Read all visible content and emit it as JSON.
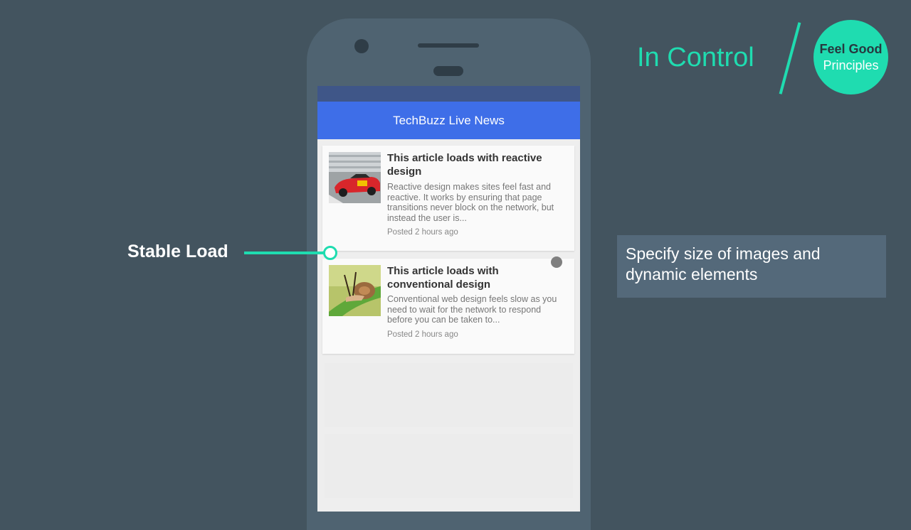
{
  "header": {
    "section_title": "In Control",
    "badge_line1": "Feel Good",
    "badge_line2": "Principles"
  },
  "callout": {
    "label": "Stable Load"
  },
  "info_box": {
    "text": "Specify size of images and dynamic elements"
  },
  "app": {
    "title": "TechBuzz Live News",
    "articles": [
      {
        "title": "This article loads with reactive design",
        "excerpt": "Reactive design makes sites feel fast and reactive. It works by ensuring that page transitions never block on the network, but instead the user is...",
        "time": "Posted 2 hours ago",
        "image": "race-car-image"
      },
      {
        "title": "This article loads with conventional design",
        "excerpt": "Conventional web design feels slow as you need to wait for the network to respond before you can be taken to...",
        "time": "Posted 2 hours ago",
        "image": "snail-image"
      }
    ]
  },
  "colors": {
    "accent": "#1fdcb0",
    "background": "#43545f",
    "app_bar": "#3e6ee8"
  }
}
